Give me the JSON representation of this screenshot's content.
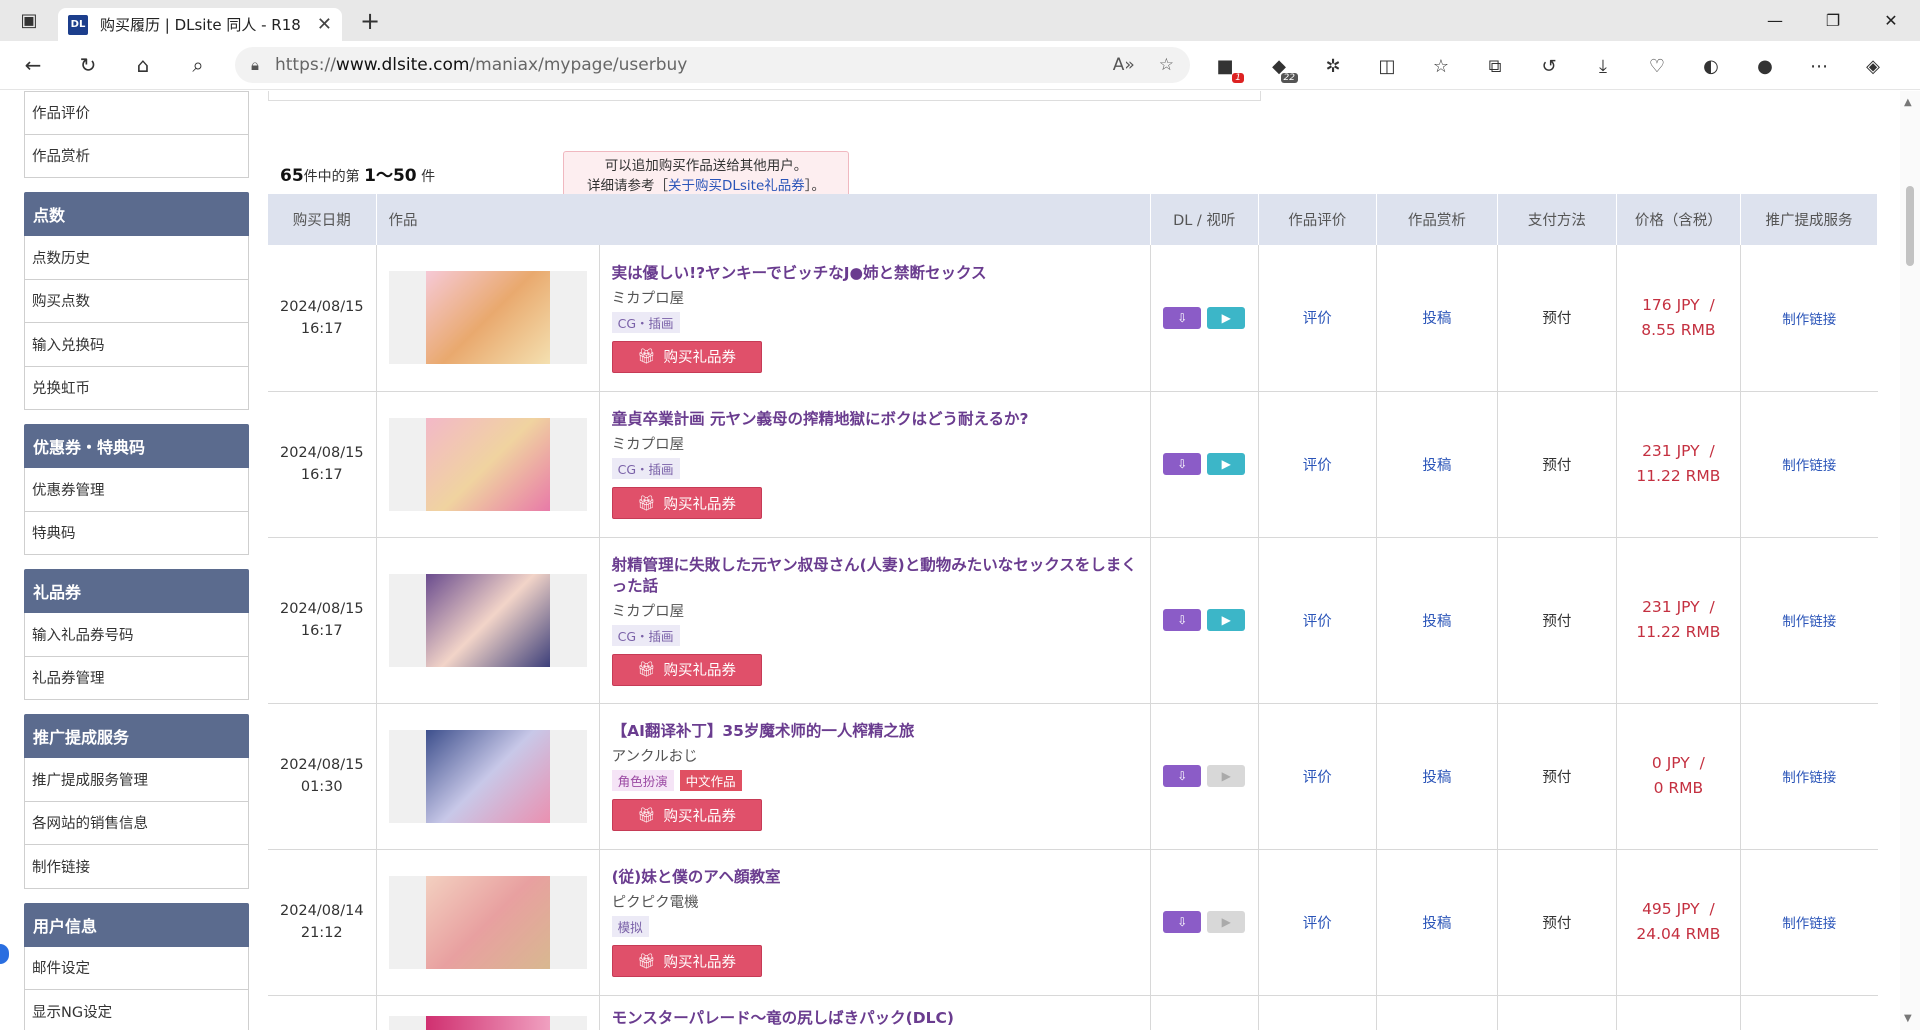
{
  "browser": {
    "tab_title": "购买履历 | DLsite 同人 - R18",
    "tab_favicon": "DL",
    "url_prefix": "https://",
    "url_domain": "www.dlsite.com",
    "url_path": "/maniax/mypage/userbuy",
    "ext_badge_1": "1",
    "ext_badge_2": "22"
  },
  "sidebar": {
    "top_items": [
      "作品评价",
      "作品赏析"
    ],
    "sections": [
      {
        "title": "点数",
        "items": [
          "点数历史",
          "购买点数",
          "输入兑换码",
          "兑换虹币"
        ]
      },
      {
        "title": "优惠券・特典码",
        "items": [
          "优惠券管理",
          "特典码"
        ]
      },
      {
        "title": "礼品券",
        "items": [
          "输入礼品券号码",
          "礼品券管理"
        ]
      },
      {
        "title": "推广提成服务",
        "items": [
          "推广提成服务管理",
          "各网站的销售信息",
          "制作链接"
        ]
      },
      {
        "title": "用户信息",
        "items": [
          "邮件设定",
          "显示NG设定"
        ]
      }
    ]
  },
  "main": {
    "count_total": "65",
    "count_mid": "件中的第",
    "count_range": "1～50",
    "count_suffix": "件",
    "tooltip_line1": "可以追加购买作品送给其他用户。",
    "tooltip_prefix": "详细请参考［",
    "tooltip_link": "关于购买DLsite礼品券",
    "tooltip_suffix": "］。",
    "headers": [
      "购买日期",
      "作品",
      "",
      "DL / 视听",
      "作品评价",
      "作品赏析",
      "支付方法",
      "价格（含税）",
      "推广提成服务"
    ],
    "gift_button": "购买礼品券",
    "review_label": "评价",
    "post_label": "投稿",
    "pay_label": "预付",
    "affiliate_label": "制作链接",
    "rows": [
      {
        "date": "2024/08/15",
        "time": "16:17",
        "title": "実は優しい!?ヤンキーでビッチなJ●姉と禁断セックス",
        "maker": "ミカプロ屋",
        "tags": [
          "CG・插画"
        ],
        "jpy": "176 JPY",
        "rmb": "8.55 RMB",
        "preview": true
      },
      {
        "date": "2024/08/15",
        "time": "16:17",
        "title": "童貞卒業計画 元ヤン義母の搾精地獄にボクはどう耐えるか?",
        "maker": "ミカプロ屋",
        "tags": [
          "CG・插画"
        ],
        "jpy": "231 JPY",
        "rmb": "11.22 RMB",
        "preview": true
      },
      {
        "date": "2024/08/15",
        "time": "16:17",
        "title": "射精管理に失敗した元ヤン叔母さん(人妻)と動物みたいなセックスをしまくった話",
        "maker": "ミカプロ屋",
        "tags": [
          "CG・插画"
        ],
        "jpy": "231 JPY",
        "rmb": "11.22 RMB",
        "preview": true
      },
      {
        "date": "2024/08/15",
        "time": "01:30",
        "title": "【AI翻译补丁】35岁魔术师的一人榨精之旅",
        "maker": "アンクルおじ",
        "tags": [
          "角色扮演",
          "中文作品"
        ],
        "jpy": "0 JPY",
        "rmb": "0 RMB",
        "preview": false
      },
      {
        "date": "2024/08/14",
        "time": "21:12",
        "title": "(従)妹と僕のアヘ顔教室",
        "maker": "ピクピク電機",
        "tags": [
          "模拟"
        ],
        "jpy": "495 JPY",
        "rmb": "24.04 RMB",
        "preview": false
      }
    ],
    "partial_row_title": "モンスターパレード～竜の尻しばきパック(DLC)"
  }
}
